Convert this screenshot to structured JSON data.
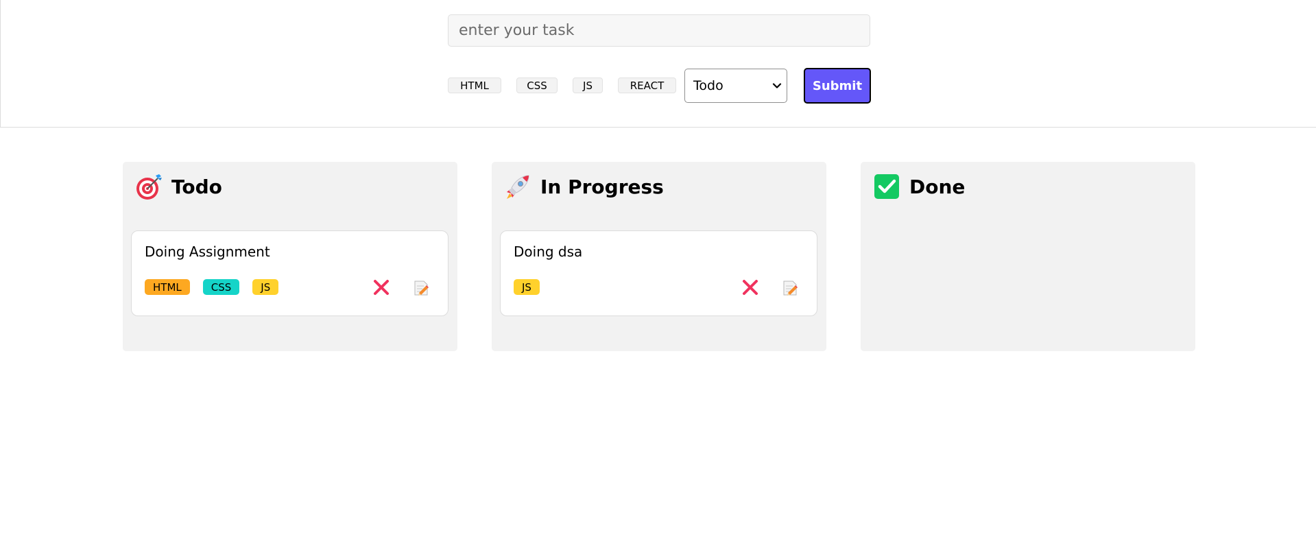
{
  "form": {
    "task_input": {
      "placeholder": "enter your task",
      "value": ""
    },
    "tag_buttons": [
      "HTML",
      "CSS",
      "JS",
      "REACT"
    ],
    "status_select": {
      "selected": "Todo"
    },
    "submit_label": "Submit"
  },
  "columns": [
    {
      "title": "Todo",
      "icon": "target-dart-icon",
      "cards": [
        {
          "title": "Doing Assignment",
          "tags": [
            {
              "label": "HTML",
              "color": "#fda821"
            },
            {
              "label": "CSS",
              "color": "#15d4c8"
            },
            {
              "label": "JS",
              "color": "#ffd12c"
            }
          ]
        }
      ]
    },
    {
      "title": "In Progress",
      "icon": "rocket-icon",
      "cards": [
        {
          "title": "Doing dsa",
          "tags": [
            {
              "label": "JS",
              "color": "#ffd12c"
            }
          ]
        }
      ]
    },
    {
      "title": "Done",
      "icon": "check-box-icon",
      "cards": []
    }
  ],
  "colors": {
    "accent": "#6457f9",
    "column_bg": "#f2f2f2",
    "delete_red": "#f0325e"
  }
}
